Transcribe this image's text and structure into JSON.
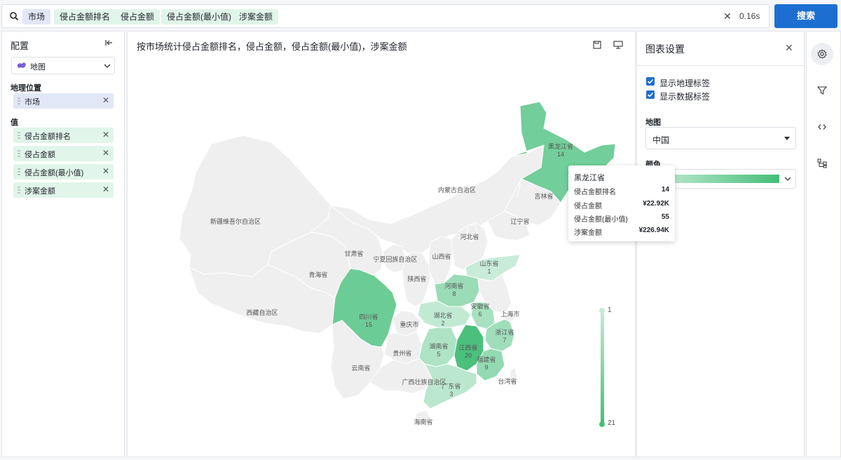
{
  "search": {
    "chips": [
      {
        "label": "市场",
        "kind": "dim"
      },
      {
        "label": "侵占金额排名",
        "kind": "val"
      },
      {
        "label": "侵占金额",
        "kind": "val"
      },
      {
        "label": "侵占金额(最小值)",
        "kind": "val"
      },
      {
        "label": "涉案金额",
        "kind": "val"
      }
    ],
    "elapsed": "0.16s",
    "button_label": "搜索"
  },
  "config": {
    "title": "配置",
    "chart_type": "地图",
    "geo_section": "地理位置",
    "geo_fields": [
      "市场"
    ],
    "value_section": "值",
    "value_fields": [
      "侵占金额排名",
      "侵占金额",
      "侵占金额(最小值)",
      "涉案金额"
    ]
  },
  "chart": {
    "title": "按市场统计侵占金额排名，侵占金额，侵占金额(最小值)，涉案金额",
    "legend_min": "1",
    "legend_max": "21"
  },
  "settings": {
    "title": "图表设置",
    "show_geo_labels": "显示地理标签",
    "show_data_labels": "显示数据标签",
    "map_label": "地图",
    "map_value": "中国",
    "color_label": "颜色"
  },
  "tooltip": {
    "title": "黑龙江省",
    "rows": [
      {
        "key": "侵占金额排名",
        "value": "14"
      },
      {
        "key": "侵占金额",
        "value": "¥22.92K"
      },
      {
        "key": "侵占金额(最小值)",
        "value": "55"
      },
      {
        "key": "涉案金额",
        "value": "¥226.94K"
      }
    ]
  },
  "colors": {
    "accent": "#1c6fd1",
    "ramp_low": "#c8ecd8",
    "ramp_high": "#44be78",
    "no_data": "#efefef"
  },
  "chart_data": {
    "type": "map",
    "map": "中国",
    "metric": "侵占金额排名",
    "scale_range": [
      1,
      21
    ],
    "regions_with_values": [
      {
        "name": "黑龙江省",
        "value": 14
      },
      {
        "name": "山东省",
        "value": 1
      },
      {
        "name": "河南省",
        "value": 8
      },
      {
        "name": "湖北省",
        "value": 2
      },
      {
        "name": "安徽省",
        "value": 6
      },
      {
        "name": "浙江省",
        "value": 7
      },
      {
        "name": "四川省",
        "value": 15
      },
      {
        "name": "湖南省",
        "value": 5
      },
      {
        "name": "江西省",
        "value": 20
      },
      {
        "name": "福建省",
        "value": 9
      },
      {
        "name": "广东省",
        "value": 3
      }
    ],
    "regions_labeled_only": [
      "新疆维吾尔自治区",
      "西藏自治区",
      "青海省",
      "甘肃省",
      "内蒙古自治区",
      "宁夏回族自治区",
      "陕西省",
      "山西省",
      "河北省",
      "吉林省",
      "辽宁省",
      "上海市",
      "重庆市",
      "贵州省",
      "云南省",
      "广西壮族自治区",
      "海南省",
      "台湾省"
    ]
  }
}
